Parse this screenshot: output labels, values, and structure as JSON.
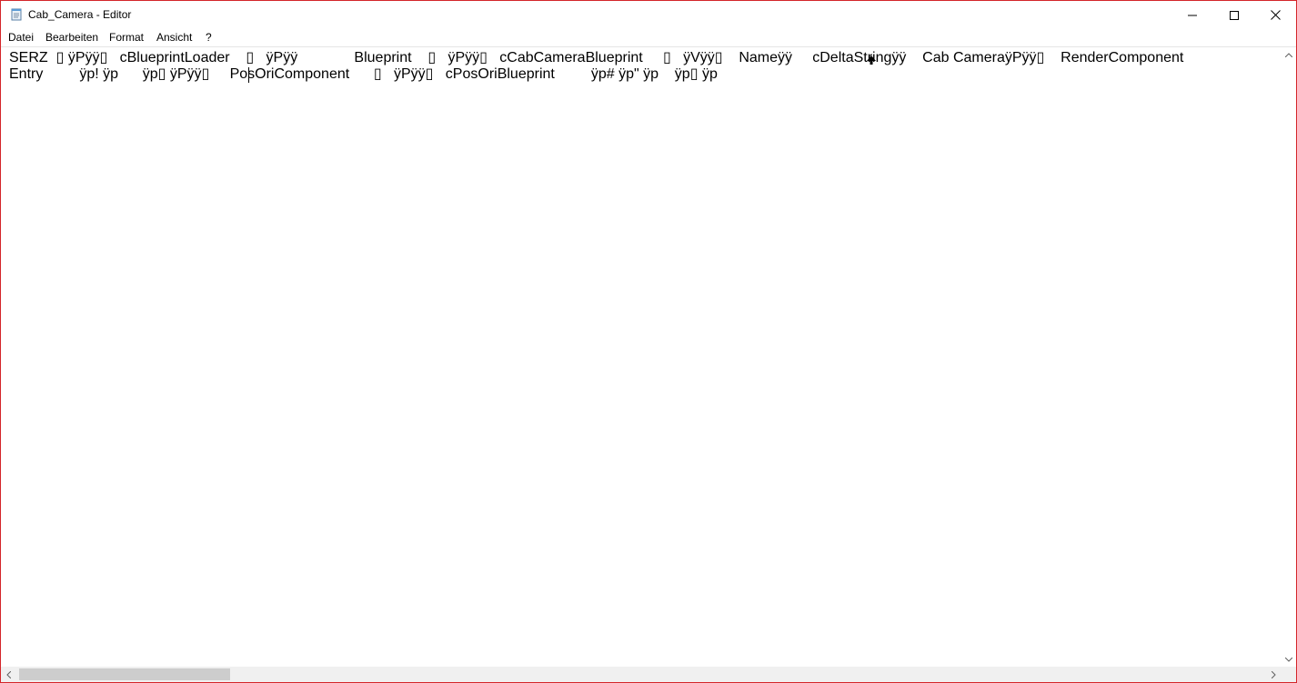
{
  "window": {
    "title": "Cab_Camera - Editor",
    "app_icon": "notepad-icon",
    "border_color": "#d4262a",
    "controls": {
      "minimize_icon": "minimize-icon",
      "maximize_icon": "maximize-icon",
      "close_icon": "close-icon"
    }
  },
  "menubar": {
    "items": [
      {
        "label": "Datei"
      },
      {
        "label": "Bearbeiten"
      },
      {
        "label": "Format"
      },
      {
        "label": "Ansicht"
      },
      {
        "label": "?"
      }
    ]
  },
  "editor": {
    "lines": [
      "SERZ  ▯ ÿPÿÿ▯   cBlueprintLoader    ▯   ÿPÿÿ              Blueprint    ▯   ÿPÿÿ▯   cCabCameraBlueprint     ▯   ÿVÿÿ▯    Nameÿÿ     cDeltaStringÿÿ    Cab CameraÿPÿÿ▯    RenderComponent",
      "Entry         ÿp! ÿp      ÿp▯ ÿPÿÿ▯     PosOriComponent      ▯   ÿPÿÿ▯   cPosOriBlueprint         ÿp# ÿp\" ÿp    ÿp▯ ÿp"
    ]
  },
  "scrollbars": {
    "vertical": {
      "up_icon": "arrow-up-icon",
      "down_icon": "arrow-down-icon"
    },
    "horizontal": {
      "left_icon": "arrow-left-icon",
      "right_icon": "arrow-right-icon"
    }
  }
}
